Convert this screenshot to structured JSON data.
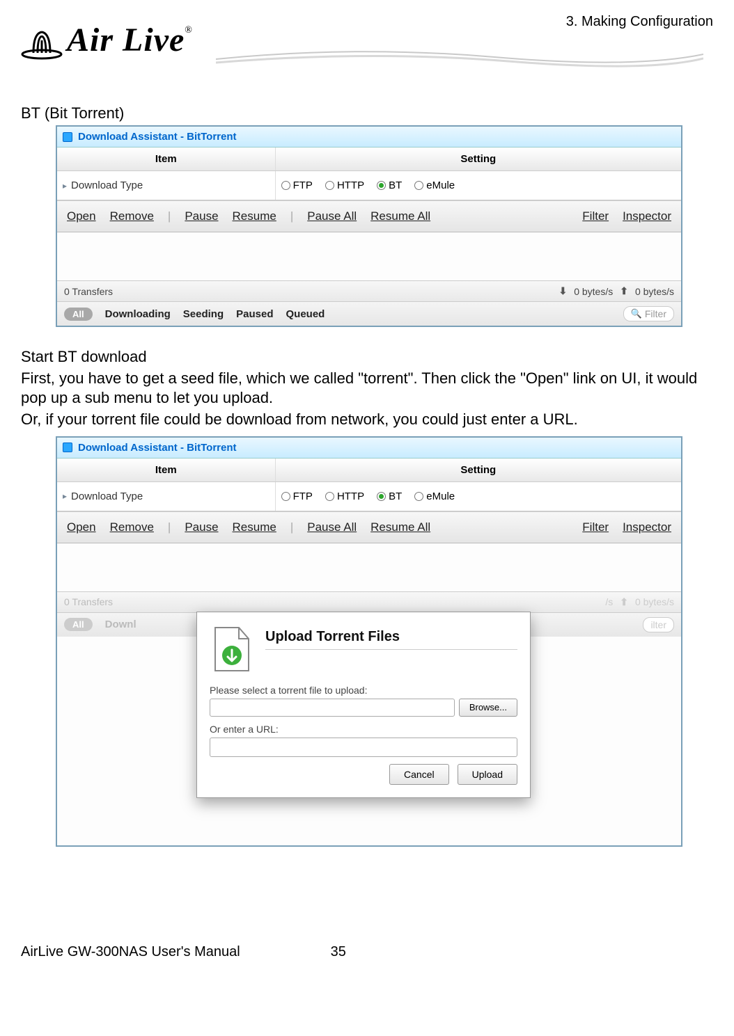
{
  "page": {
    "chapter": "3. Making Configuration",
    "logo_text": "Air Live",
    "footer_manual": "AirLive GW-300NAS User's Manual",
    "footer_page": "35"
  },
  "text": {
    "section1": "BT (Bit Torrent)",
    "section2": "Start BT download",
    "para1": "First, you have to get a seed file, which we called \"torrent\". Then click the \"Open\" link on UI, it would pop up a sub menu to let you upload.",
    "para2": "Or, if your torrent file could be download from network, you could just enter a URL."
  },
  "panel": {
    "title": "Download Assistant - BitTorrent",
    "col_item": "Item",
    "col_setting": "Setting",
    "row_label": "Download Type",
    "radios": {
      "ftp": "FTP",
      "http": "HTTP",
      "bt": "BT",
      "emule": "eMule"
    },
    "selected": "bt"
  },
  "toolbar": {
    "open": "Open",
    "remove": "Remove",
    "pause": "Pause",
    "resume": "Resume",
    "pause_all": "Pause All",
    "resume_all": "Resume All",
    "filter": "Filter",
    "inspector": "Inspector",
    "sep": "|"
  },
  "status": {
    "transfers": "0 Transfers",
    "down_rate": "0 bytes/s",
    "up_rate": "0 bytes/s"
  },
  "filters": {
    "all": "All",
    "downloading": "Downloading",
    "seeding": "Seeding",
    "paused": "Paused",
    "queued": "Queued",
    "search_placeholder": "Filter"
  },
  "dialog": {
    "title": "Upload Torrent Files",
    "label_file": "Please select a torrent file to upload:",
    "browse": "Browse...",
    "label_url": "Or enter a URL:",
    "cancel": "Cancel",
    "upload": "Upload"
  }
}
